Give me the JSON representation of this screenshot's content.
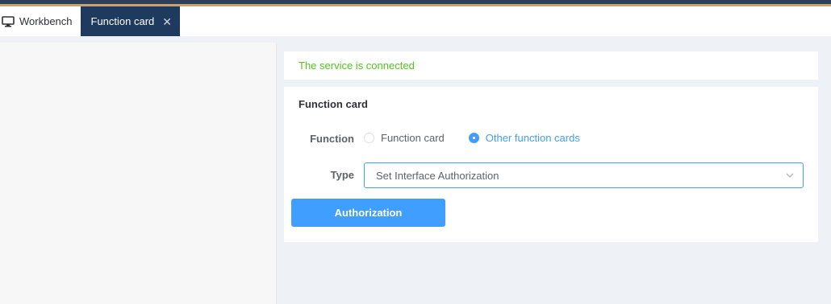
{
  "tabs": [
    {
      "label": "Workbench",
      "icon": "monitor-icon"
    },
    {
      "label": "Function card",
      "active": true,
      "icon": "close-icon"
    }
  ],
  "status": {
    "text": "The service is connected",
    "color": "#52c41a"
  },
  "card": {
    "title": "Function card",
    "function_label": "Function",
    "radio_options": [
      {
        "label": "Function card",
        "checked": false
      },
      {
        "label": "Other function cards",
        "checked": true
      }
    ],
    "type_label": "Type",
    "type_value": "Set Interface Authorization",
    "button_label": "Authorization"
  },
  "colors": {
    "accent": "#409eff",
    "tab_active": "#1f3a5f",
    "success": "#52c41a"
  }
}
